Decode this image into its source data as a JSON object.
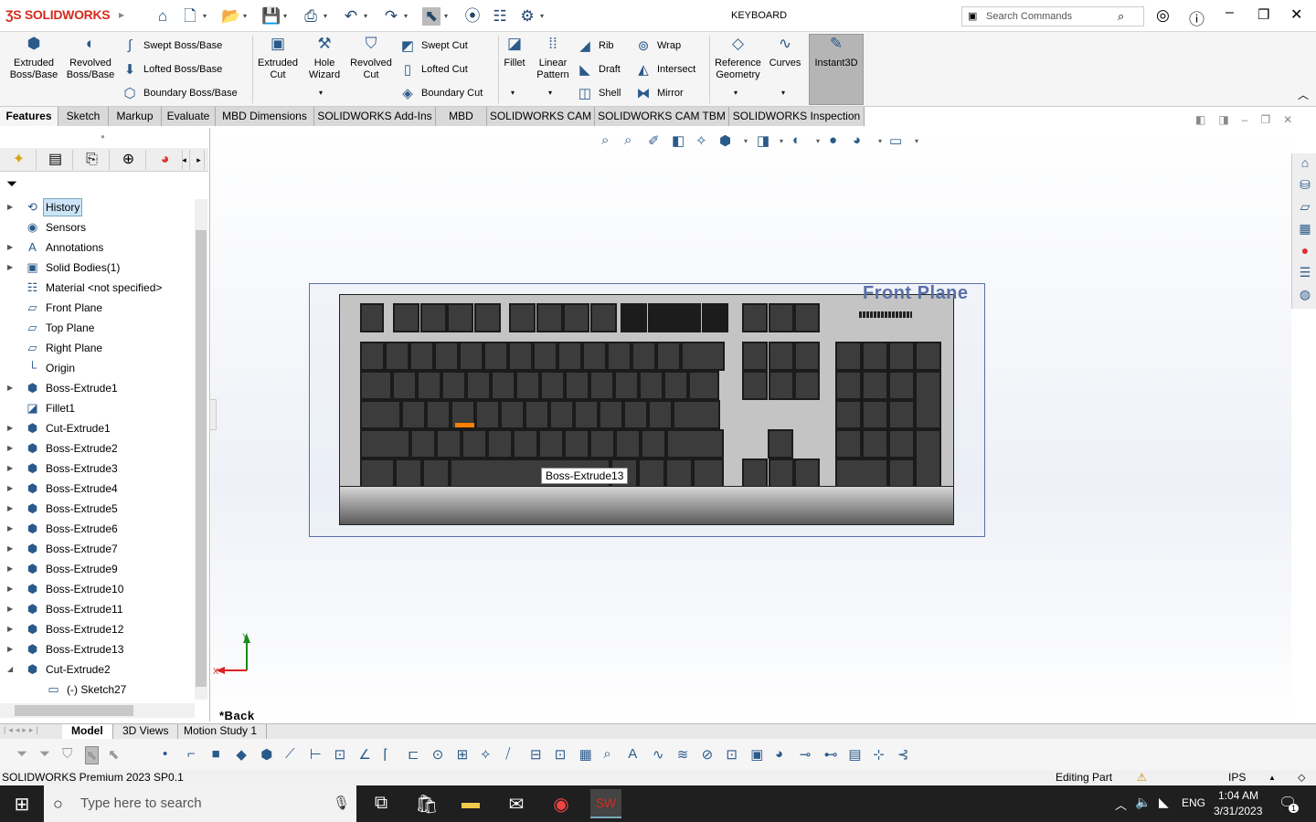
{
  "app": {
    "brand": "SOLIDWORKS",
    "document_title": "KEYBOARD",
    "search_placeholder": "Search Commands"
  },
  "quick_access": [
    {
      "icon": "home-icon"
    },
    {
      "icon": "new-document-icon"
    },
    {
      "icon": "open-icon"
    },
    {
      "icon": "save-icon"
    },
    {
      "icon": "print-icon"
    },
    {
      "icon": "undo-icon"
    },
    {
      "icon": "redo-icon"
    },
    {
      "icon": "select-cursor-icon"
    },
    {
      "icon": "rebuild-traffic-light-icon"
    },
    {
      "icon": "file-properties-icon"
    },
    {
      "icon": "options-gear-icon"
    }
  ],
  "ribbon": {
    "big": [
      {
        "label": "Extruded\nBoss/Base",
        "icon": "extruded-boss-icon"
      },
      {
        "label": "Revolved\nBoss/Base",
        "icon": "revolved-boss-icon"
      },
      {
        "label": "Extruded\nCut",
        "icon": "extruded-cut-icon"
      },
      {
        "label": "Hole\nWizard",
        "icon": "hole-wizard-icon"
      },
      {
        "label": "Revolved\nCut",
        "icon": "revolved-cut-icon"
      },
      {
        "label": "Fillet",
        "icon": "fillet-icon"
      },
      {
        "label": "Linear\nPattern",
        "icon": "linear-pattern-icon"
      },
      {
        "label": "Reference\nGeometry",
        "icon": "reference-geometry-icon"
      },
      {
        "label": "Curves",
        "icon": "curves-icon"
      },
      {
        "label": "Instant3D",
        "icon": "instant3d-icon"
      }
    ],
    "small": [
      {
        "label": "Swept Boss/Base"
      },
      {
        "label": "Lofted Boss/Base"
      },
      {
        "label": "Boundary Boss/Base"
      },
      {
        "label": "Swept Cut"
      },
      {
        "label": "Lofted Cut"
      },
      {
        "label": "Boundary Cut"
      },
      {
        "label": "Rib"
      },
      {
        "label": "Draft"
      },
      {
        "label": "Shell"
      },
      {
        "label": "Wrap"
      },
      {
        "label": "Intersect"
      },
      {
        "label": "Mirror"
      }
    ]
  },
  "tabs": [
    {
      "label": "Features",
      "active": true
    },
    {
      "label": "Sketch"
    },
    {
      "label": "Markup"
    },
    {
      "label": "Evaluate"
    },
    {
      "label": "MBD Dimensions"
    },
    {
      "label": "SOLIDWORKS Add-Ins"
    },
    {
      "label": "MBD"
    },
    {
      "label": "SOLIDWORKS CAM"
    },
    {
      "label": "SOLIDWORKS CAM TBM"
    },
    {
      "label": "SOLIDWORKS Inspection"
    }
  ],
  "tree": [
    {
      "label": "History",
      "expand": true,
      "selected": true,
      "icon": "history-icon"
    },
    {
      "label": "Sensors",
      "icon": "sensor-icon"
    },
    {
      "label": "Annotations",
      "expand": true,
      "icon": "annotations-icon"
    },
    {
      "label": "Solid Bodies(1)",
      "expand": true,
      "icon": "solid-bodies-icon"
    },
    {
      "label": "Material <not specified>",
      "icon": "material-icon"
    },
    {
      "label": "Front Plane",
      "icon": "plane-icon"
    },
    {
      "label": "Top Plane",
      "icon": "plane-icon"
    },
    {
      "label": "Right Plane",
      "icon": "plane-icon"
    },
    {
      "label": "Origin",
      "icon": "origin-icon"
    },
    {
      "label": "Boss-Extrude1",
      "expand": true,
      "icon": "extrude-icon"
    },
    {
      "label": "Fillet1",
      "icon": "fillet-icon"
    },
    {
      "label": "Cut-Extrude1",
      "expand": true,
      "icon": "extrude-icon"
    },
    {
      "label": "Boss-Extrude2",
      "expand": true,
      "icon": "extrude-icon"
    },
    {
      "label": "Boss-Extrude3",
      "expand": true,
      "icon": "extrude-icon"
    },
    {
      "label": "Boss-Extrude4",
      "expand": true,
      "icon": "extrude-icon"
    },
    {
      "label": "Boss-Extrude5",
      "expand": true,
      "icon": "extrude-icon"
    },
    {
      "label": "Boss-Extrude6",
      "expand": true,
      "icon": "extrude-icon"
    },
    {
      "label": "Boss-Extrude7",
      "expand": true,
      "icon": "extrude-icon"
    },
    {
      "label": "Boss-Extrude9",
      "expand": true,
      "icon": "extrude-icon"
    },
    {
      "label": "Boss-Extrude10",
      "expand": true,
      "icon": "extrude-icon"
    },
    {
      "label": "Boss-Extrude11",
      "expand": true,
      "icon": "extrude-icon"
    },
    {
      "label": "Boss-Extrude12",
      "expand": true,
      "icon": "extrude-icon"
    },
    {
      "label": "Boss-Extrude13",
      "expand": true,
      "icon": "extrude-icon"
    },
    {
      "label": "Cut-Extrude2",
      "expanded": true,
      "icon": "extrude-icon"
    },
    {
      "label": "(-) Sketch27",
      "child": true,
      "icon": "sketch-icon"
    }
  ],
  "viewport": {
    "plane_label": "Front Plane",
    "tooltip": "Boss-Extrude13",
    "view_label": "*Back",
    "axis_y": "Y",
    "axis_x": "X",
    "highlight_color": "#ff7f00"
  },
  "bottom_tabs": [
    {
      "label": "Model",
      "active": true
    },
    {
      "label": "3D Views"
    },
    {
      "label": "Motion Study 1"
    }
  ],
  "status": {
    "product": "SOLIDWORKS Premium 2023 SP0.1",
    "mode": "Editing Part",
    "units": "IPS"
  },
  "taskbar": {
    "search_placeholder": "Type here to search",
    "language": "ENG",
    "time": "1:04 AM",
    "date": "3/31/2023",
    "notifications": "1"
  }
}
